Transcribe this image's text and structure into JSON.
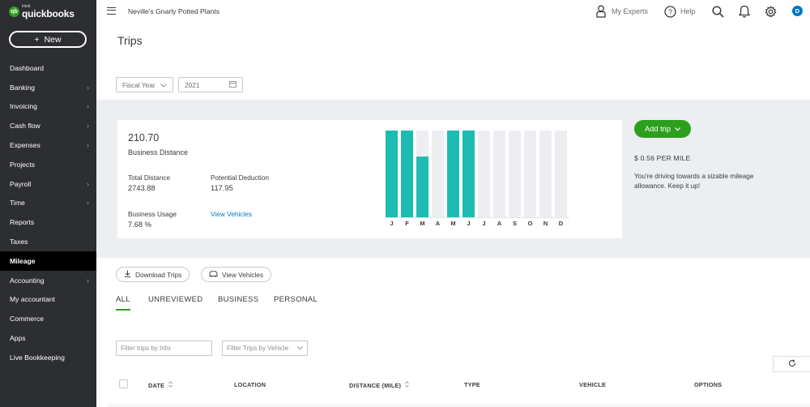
{
  "brand": {
    "logo_small": "intuit",
    "logo_main": "quickbooks",
    "logo_mark": "qb"
  },
  "sidebar": {
    "new_button": "New",
    "items": [
      {
        "label": "Dashboard",
        "chevron": false
      },
      {
        "label": "Banking",
        "chevron": true
      },
      {
        "label": "Invoicing",
        "chevron": true
      },
      {
        "label": "Cash flow",
        "chevron": true
      },
      {
        "label": "Expenses",
        "chevron": true
      },
      {
        "label": "Projects",
        "chevron": false
      },
      {
        "label": "Payroll",
        "chevron": true
      },
      {
        "label": "Time",
        "chevron": true
      },
      {
        "label": "Reports",
        "chevron": false
      },
      {
        "label": "Taxes",
        "chevron": false
      },
      {
        "label": "Mileage",
        "chevron": false,
        "active": true
      },
      {
        "label": "Accounting",
        "chevron": true
      },
      {
        "label": "My accountant",
        "chevron": false
      },
      {
        "label": "Commerce",
        "chevron": false
      },
      {
        "label": "Apps",
        "chevron": false
      },
      {
        "label": "Live Bookkeeping",
        "chevron": false
      }
    ]
  },
  "topbar": {
    "company_name": "Neville's Gnarly Potted Plants",
    "my_experts": "My Experts",
    "help": "Help",
    "avatar_initial": "D"
  },
  "page": {
    "title": "Trips"
  },
  "filters": {
    "period": "Fiscal Year",
    "year": "2021"
  },
  "summary": {
    "business_distance_value": "210.70",
    "business_distance_label": "Business Distance",
    "total_distance_label": "Total Distance",
    "total_distance_value": "2743.88",
    "potential_deduction_label": "Potential Deduction",
    "potential_deduction_value": "117.95",
    "business_usage_label": "Business Usage",
    "business_usage_value": "7.68 %",
    "view_vehicles_link": "View Vehicles"
  },
  "chart_data": {
    "type": "bar",
    "categories": [
      "J",
      "F",
      "M",
      "A",
      "M",
      "J",
      "J",
      "A",
      "S",
      "O",
      "N",
      "D"
    ],
    "values": [
      1,
      1,
      0.7,
      0,
      1,
      1,
      0,
      0,
      0,
      0,
      0,
      0
    ],
    "ylim": [
      0,
      1
    ],
    "colors": {
      "filled": "#1cbcb3",
      "empty": "#eceef1"
    }
  },
  "actions": {
    "add_trip": "Add trip",
    "rate": "$ 0.56 PER MILE",
    "rate_message": "You're driving towards a sizable mileage allowance. Keep it up!",
    "download_trips": "Download Trips",
    "view_vehicles": "View Vehicles"
  },
  "tabs": [
    "ALL",
    "UNREVIEWED",
    "BUSINESS",
    "PERSONAL"
  ],
  "search": {
    "info_placeholder": "Filter trips by Info",
    "vehicle_placeholder": "Filter Trips by Vehicle"
  },
  "table": {
    "columns": [
      "DATE",
      "LOCATION",
      "DISTANCE (MILE)",
      "TYPE",
      "VEHICLE",
      "OPTIONS"
    ]
  },
  "colors": {
    "sidebar": "#2d2e31",
    "accent_green": "#2ca01c",
    "link_blue": "#0077c5",
    "bar_teal": "#1cbcb3"
  }
}
